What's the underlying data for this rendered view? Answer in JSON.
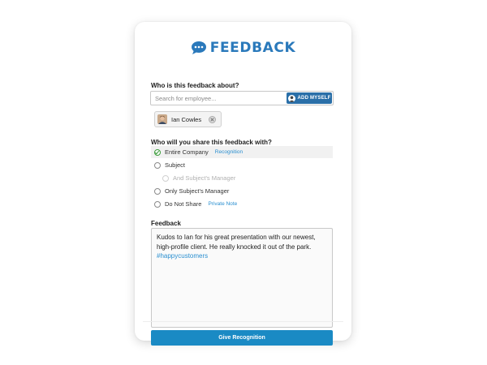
{
  "header": {
    "title": "FEEDBACK",
    "icon": "speech-bubble-icon"
  },
  "about": {
    "label": "Who is this feedback about?",
    "search_placeholder": "Search for employee...",
    "add_myself_label": "ADD MYSELF",
    "selected_employee": "Ian Cowles"
  },
  "share": {
    "label": "Who will you share this feedback with?",
    "options": [
      {
        "label": "Entire Company",
        "tag": "Recognition",
        "selected": true
      },
      {
        "label": "Subject",
        "tag": ""
      },
      {
        "label": "And Subject's Manager",
        "tag": "",
        "disabled": true
      },
      {
        "label": "Only Subject's Manager",
        "tag": ""
      },
      {
        "label": "Do Not Share",
        "tag": "Private Note"
      }
    ]
  },
  "feedback": {
    "label": "Feedback",
    "text": "Kudos to Ian for his great presentation with our newest, high-profile client. He really knocked it out of the park.",
    "hashtag": "#happycustomers"
  },
  "submit_label": "Give Recognition",
  "colors": {
    "brand": "#2a79bb",
    "button": "#1a8ac4",
    "link": "#2a8fd0",
    "check": "#3b9c3b"
  }
}
